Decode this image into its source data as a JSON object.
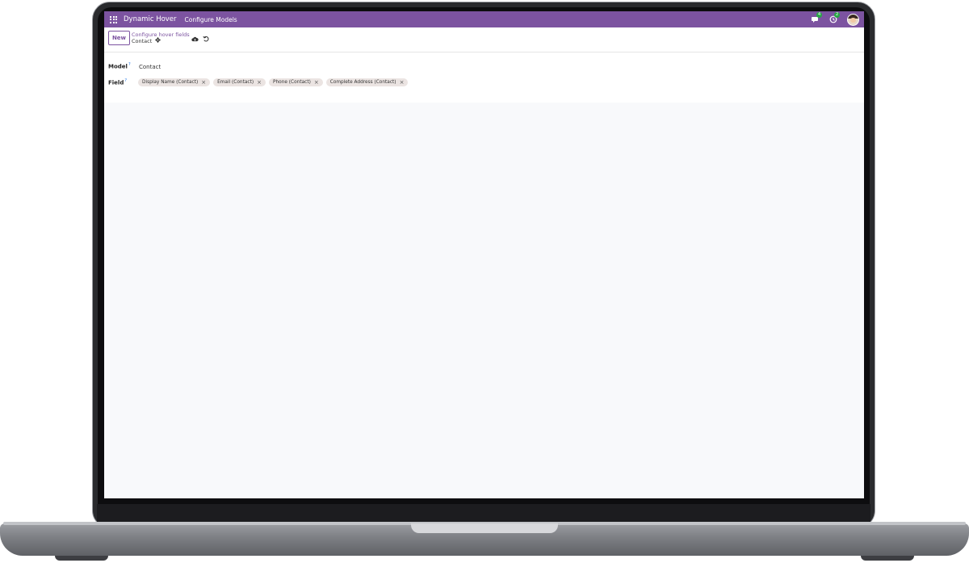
{
  "navbar": {
    "app_name": "Dynamic Hover",
    "menu_item": "Configure Models",
    "chat_badge": "4",
    "activity_badge": "2",
    "icons": {
      "apps": "apps-grid-icon",
      "chat": "chat-icon",
      "activity": "clock-icon"
    }
  },
  "control_panel": {
    "new_label": "New",
    "breadcrumb": "Configure hover fields",
    "record_name": "Contact"
  },
  "form": {
    "model_label": "Model",
    "model_help": "?",
    "model_value": "Contact",
    "field_label": "Field",
    "field_help": "?",
    "field_tags": [
      "Display Name (Contact)",
      "Email (Contact)",
      "Phone (Contact)",
      "Complete Address (Contact)"
    ]
  },
  "colors": {
    "navbar": "#7c53a0",
    "primary": "#7c53a0",
    "tag_bg": "#ebe4e2",
    "background": "#f8f9fb"
  }
}
